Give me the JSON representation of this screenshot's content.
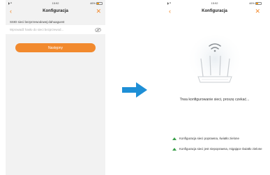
{
  "left_screen": {
    "status": {
      "time": "15:92",
      "battery": "46%"
    },
    "title": "Konfiguracja",
    "ssid_label": "SSID sieci bezprzewodowej:dahuaguest",
    "password_placeholder": "Wprowadź hasło do sieci bezprzewod...",
    "button_label": "Następny"
  },
  "right_screen": {
    "status": {
      "time": "15:92",
      "battery": "46%"
    },
    "title": "Konfiguracja",
    "message": "Trwa konfigurowanie sieci, proszę czekać...",
    "legend": [
      {
        "text": "Konfiguracja sieci poprawna, światło zielone"
      },
      {
        "text": "Konfiguracja sieci jest niepoprawna, migające światło zielone"
      }
    ]
  },
  "colors": {
    "accent": "#f28a2e",
    "arrow": "#1e8fd6",
    "green": "#3aa04a"
  },
  "icons": [
    "back-icon",
    "close-icon",
    "eye-icon",
    "wifi-icon",
    "router-icon",
    "arrow-right-icon",
    "wifi-signal-icon",
    "battery-icon"
  ]
}
